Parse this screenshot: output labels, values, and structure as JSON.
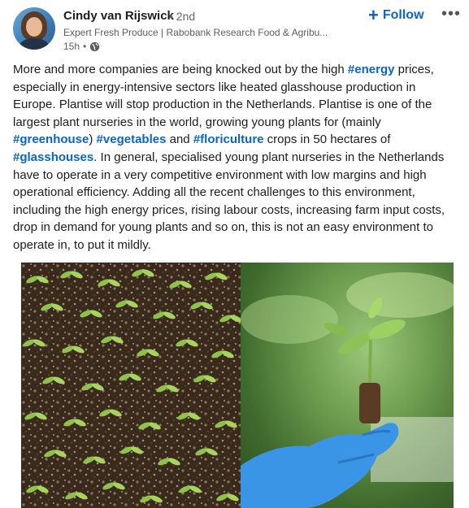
{
  "author": {
    "name": "Cindy van Rijswick",
    "degree": "• 2nd",
    "headline": "Expert Fresh Produce | Rabobank Research Food & Agribu...",
    "time": "15h",
    "visibility_icon": "globe-icon"
  },
  "actions": {
    "follow_icon": "plus-icon",
    "follow_label": "Follow",
    "more_label": "•••",
    "more_icon": "ellipsis-icon"
  },
  "post": {
    "p1": "More and more companies are being knocked out by the high ",
    "tag_energy": "#energy",
    "p2": " prices, especially in energy-intensive sectors like heated glasshouse production in Europe. Plantise will stop production in the Netherlands. Plantise is one of the largest plant nurseries in the world, growing young plants for (mainly ",
    "tag_greenhouse": "#greenhouse",
    "p3": ") ",
    "tag_vegetables": "#vegetables",
    "p4": " and ",
    "tag_floriculture": "#floriculture",
    "p5": " crops in 50 hectares of ",
    "tag_glasshouses": "#glasshouses",
    "p6": ". In general, specialised young plant nurseries in the Netherlands have to operate in a very competitive environment with low margins and high operational efficiency. Adding all the recent challenges to this environment, including the high energy prices, rising labour costs, increasing farm input costs, drop in demand for young plants and so on, this is not an easy environment to operate in, to put it mildly."
  },
  "colors": {
    "link": "#0a66c2",
    "text": "#1d1d1d",
    "muted": "#5e5e5e"
  }
}
